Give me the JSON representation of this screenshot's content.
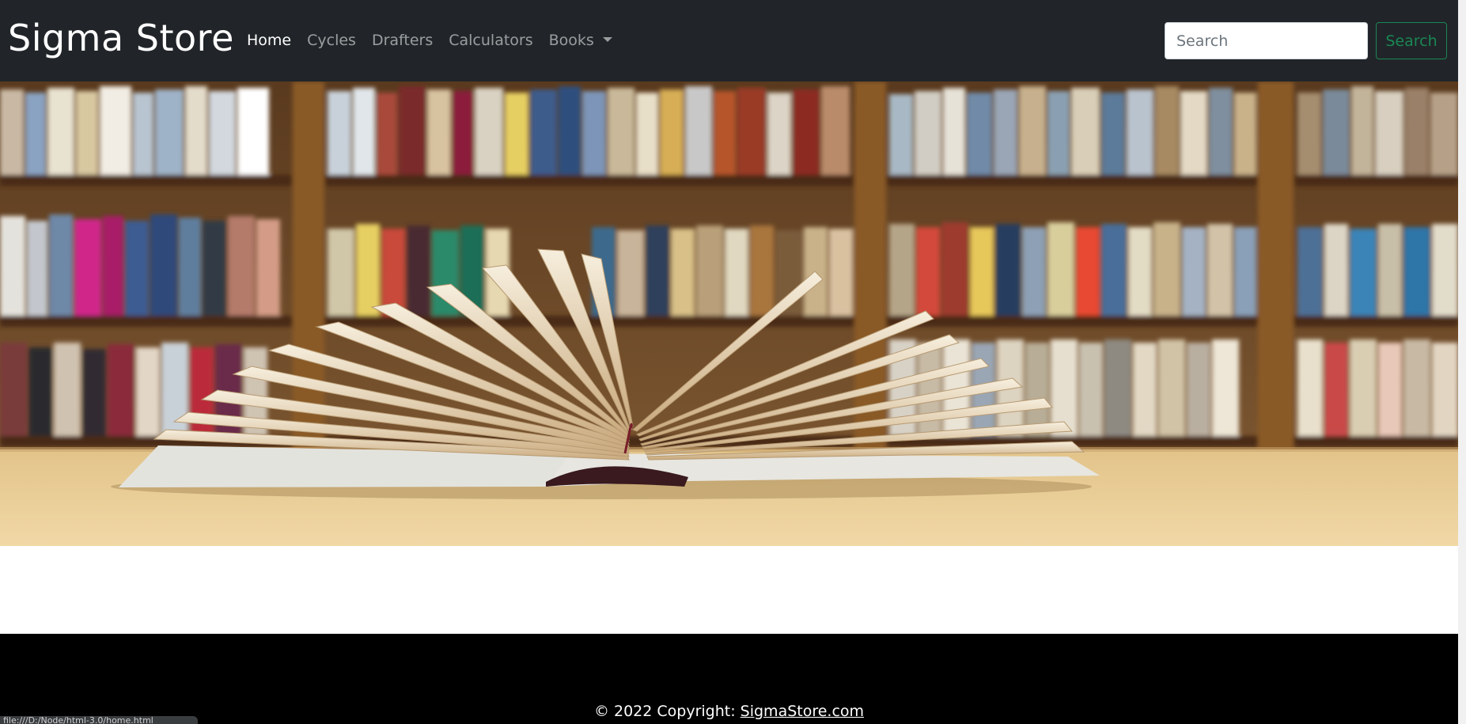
{
  "navbar": {
    "brand": "Sigma Store",
    "links": [
      {
        "label": "Home",
        "active": true
      },
      {
        "label": "Cycles",
        "active": false
      },
      {
        "label": "Drafters",
        "active": false
      },
      {
        "label": "Calculators",
        "active": false
      },
      {
        "label": "Books",
        "active": false,
        "dropdown": true
      }
    ],
    "search": {
      "placeholder": "Search",
      "button_label": "Search"
    }
  },
  "hero": {
    "image": "open-book-on-library-table-image"
  },
  "footer": {
    "copyright_prefix": "© 2022 Copyright: ",
    "copyright_link": "SigmaStore.com"
  },
  "statusbar": {
    "text": "file:///D:/Node/html-3.0/home.html"
  },
  "colors": {
    "navbar_bg": "#212529",
    "footer_bg": "#000000",
    "search_button_accent": "#198754"
  }
}
